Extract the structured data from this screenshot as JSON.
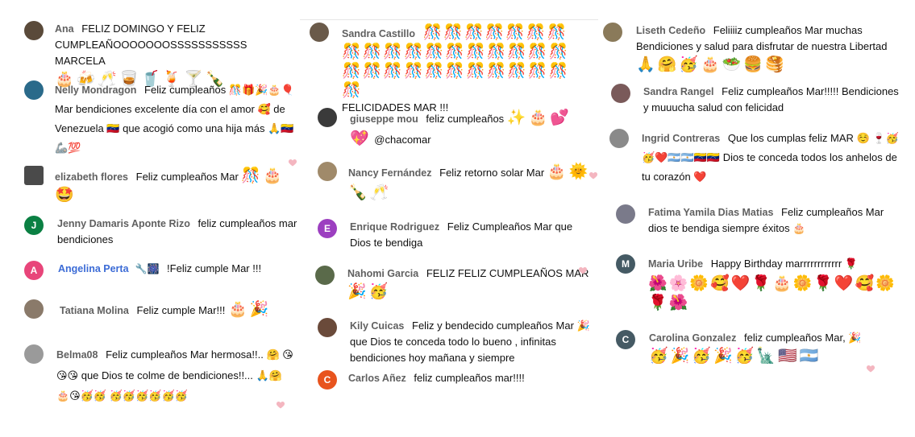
{
  "comments": [
    {
      "author": "Ana",
      "text": "FELIZ DOMINGO Y FELIZ CUMPLEAÑOOOOOOOSSSSSSSSSSS MARCELA",
      "emoji": "🎂🍻🥂🥃🥤🍹🍸🍾",
      "initial": "",
      "avatar_color": "#5a4a3a"
    },
    {
      "author": "Nelly Mondragon",
      "text": "Feliz cumpleaños 🎊🎁🎉🎂🎈 Mar bendiciones excelente día con el amor 🥰 de Venezuela 🇻🇪 que acogió como una hija más 🙏🇻🇪🦾💯",
      "initial": "",
      "avatar_color": "#2a6a8a"
    },
    {
      "author": "elizabeth flores",
      "text": "Feliz cumpleaños Mar",
      "emoji": "🎊🎂🤩",
      "initial": "",
      "avatar_color": "#4a4a4a"
    },
    {
      "author": "Jenny Damaris Aponte Rizo",
      "text": "feliz cumpleaños mar bendiciones",
      "initial": "J",
      "avatar_color": "#0b8043"
    },
    {
      "author": "Angelina Perta",
      "text": "!Feliz cumple Mar !!!",
      "initial": "A",
      "avatar_color": "#e8457a"
    },
    {
      "author": "Tatiana Molina",
      "text": "Feliz cumple Mar!!!",
      "emoji": "🎂🎉",
      "initial": "",
      "avatar_color": "#8a7a6a"
    },
    {
      "author": "Belma08",
      "text": "Feliz cumpleaños Mar hermosa!!.. 🤗 😘😘😘 que Dios te colme de bendiciones!!... 🙏🤗🎂😘🥳🥳 🥳🥳🥳🥳🥳🥳",
      "initial": "",
      "avatar_color": "#9a9a9a"
    },
    {
      "author": "Sandra Castillo",
      "text": "",
      "emoji": "🎊🎊🎊🎊🎊🎊🎊🎊🎊🎊🎊🎊🎊🎊🎊🎊🎊🎊🎊🎊🎊🎊🎊🎊🎊🎊🎊🎊🎊🎊",
      "text2": "FELICIDADES MAR !!!",
      "initial": "",
      "avatar_color": "#6a5a4a"
    },
    {
      "author": "giuseppe mou",
      "text": "feliz cumpleaños",
      "emoji": "✨🎂💕💖",
      "text2": "@chacomar",
      "initial": "",
      "avatar_color": "#3a3a3a"
    },
    {
      "author": "Nancy Fernández",
      "text": "Feliz retorno solar Mar",
      "emoji": "🎂🌞🍾🥂",
      "initial": "",
      "avatar_color": "#a08a6a"
    },
    {
      "author": "Enrique Rodriguez",
      "text": "Feliz Cumpleaños Mar que Dios te bendiga",
      "initial": "E",
      "avatar_color": "#9c3fc0"
    },
    {
      "author": "Nahomi Garcia",
      "text": "FELIZ FELIZ CUMPLEAÑOS MAR",
      "emoji": "🎉🥳",
      "initial": "",
      "avatar_color": "#5a6a4a"
    },
    {
      "author": "Kily Cuicas",
      "text": "Feliz y bendecido cumpleaños Mar 🎉 que Dios te conceda todo lo bueno , infinitas bendiciones hoy mañana y siempre",
      "initial": "",
      "avatar_color": "#6a4a3a"
    },
    {
      "author": "Carlos Añez",
      "text": "feliz cumpleaños mar!!!!",
      "initial": "C",
      "avatar_color": "#e8541e"
    },
    {
      "author": "Liseth Cedeño",
      "text": "Feliiiiz cumpleaños Mar muchas Bendiciones y salud para disfrutar de nuestra Libertad",
      "emoji": "🙏🤗🥳🎂🥗🍔🥞",
      "initial": "",
      "avatar_color": "#8a7a5a"
    },
    {
      "author": "Sandra Rangel",
      "text": "Feliz cumpleaños Mar!!!!! Bendiciones y muuucha salud con felicidad",
      "initial": "",
      "avatar_color": "#7a5a5a"
    },
    {
      "author": "Ingrid Contreras",
      "text": "Que los cumplas feliz MAR ☺️ 🍷🥳🥳❤️🇦🇷🇦🇷🇻🇪🇻🇪 Dios te conceda todos los anhelos de tu corazón ❤️",
      "initial": "",
      "avatar_color": "#8a8a8a"
    },
    {
      "author": "Fatima Yamila Dias Matias",
      "text": "Feliz cumpleaños Mar dios te bendiga siempre éxitos 🎂",
      "initial": "",
      "avatar_color": "#7a7a8a"
    },
    {
      "author": "Maria Uribe",
      "text": "Happy Birthday marrrrrrrrrrrr 🌹",
      "emoji": "🌺🌸🌼🥰❤️🌹🎂🌼🌹❤️🥰🌼🌹🌺",
      "initial": "M",
      "avatar_color": "#455a64"
    },
    {
      "author": "Carolina Gonzalez",
      "text": "feliz cumpleaños Mar, 🎉",
      "emoji": "🥳🎉🥳🎉🥳🗽🇺🇸🇦🇷",
      "initial": "C",
      "avatar_color": "#455a64"
    }
  ],
  "angelina_icons": "🔧🎆",
  "heart_color": "#f4b6c0"
}
